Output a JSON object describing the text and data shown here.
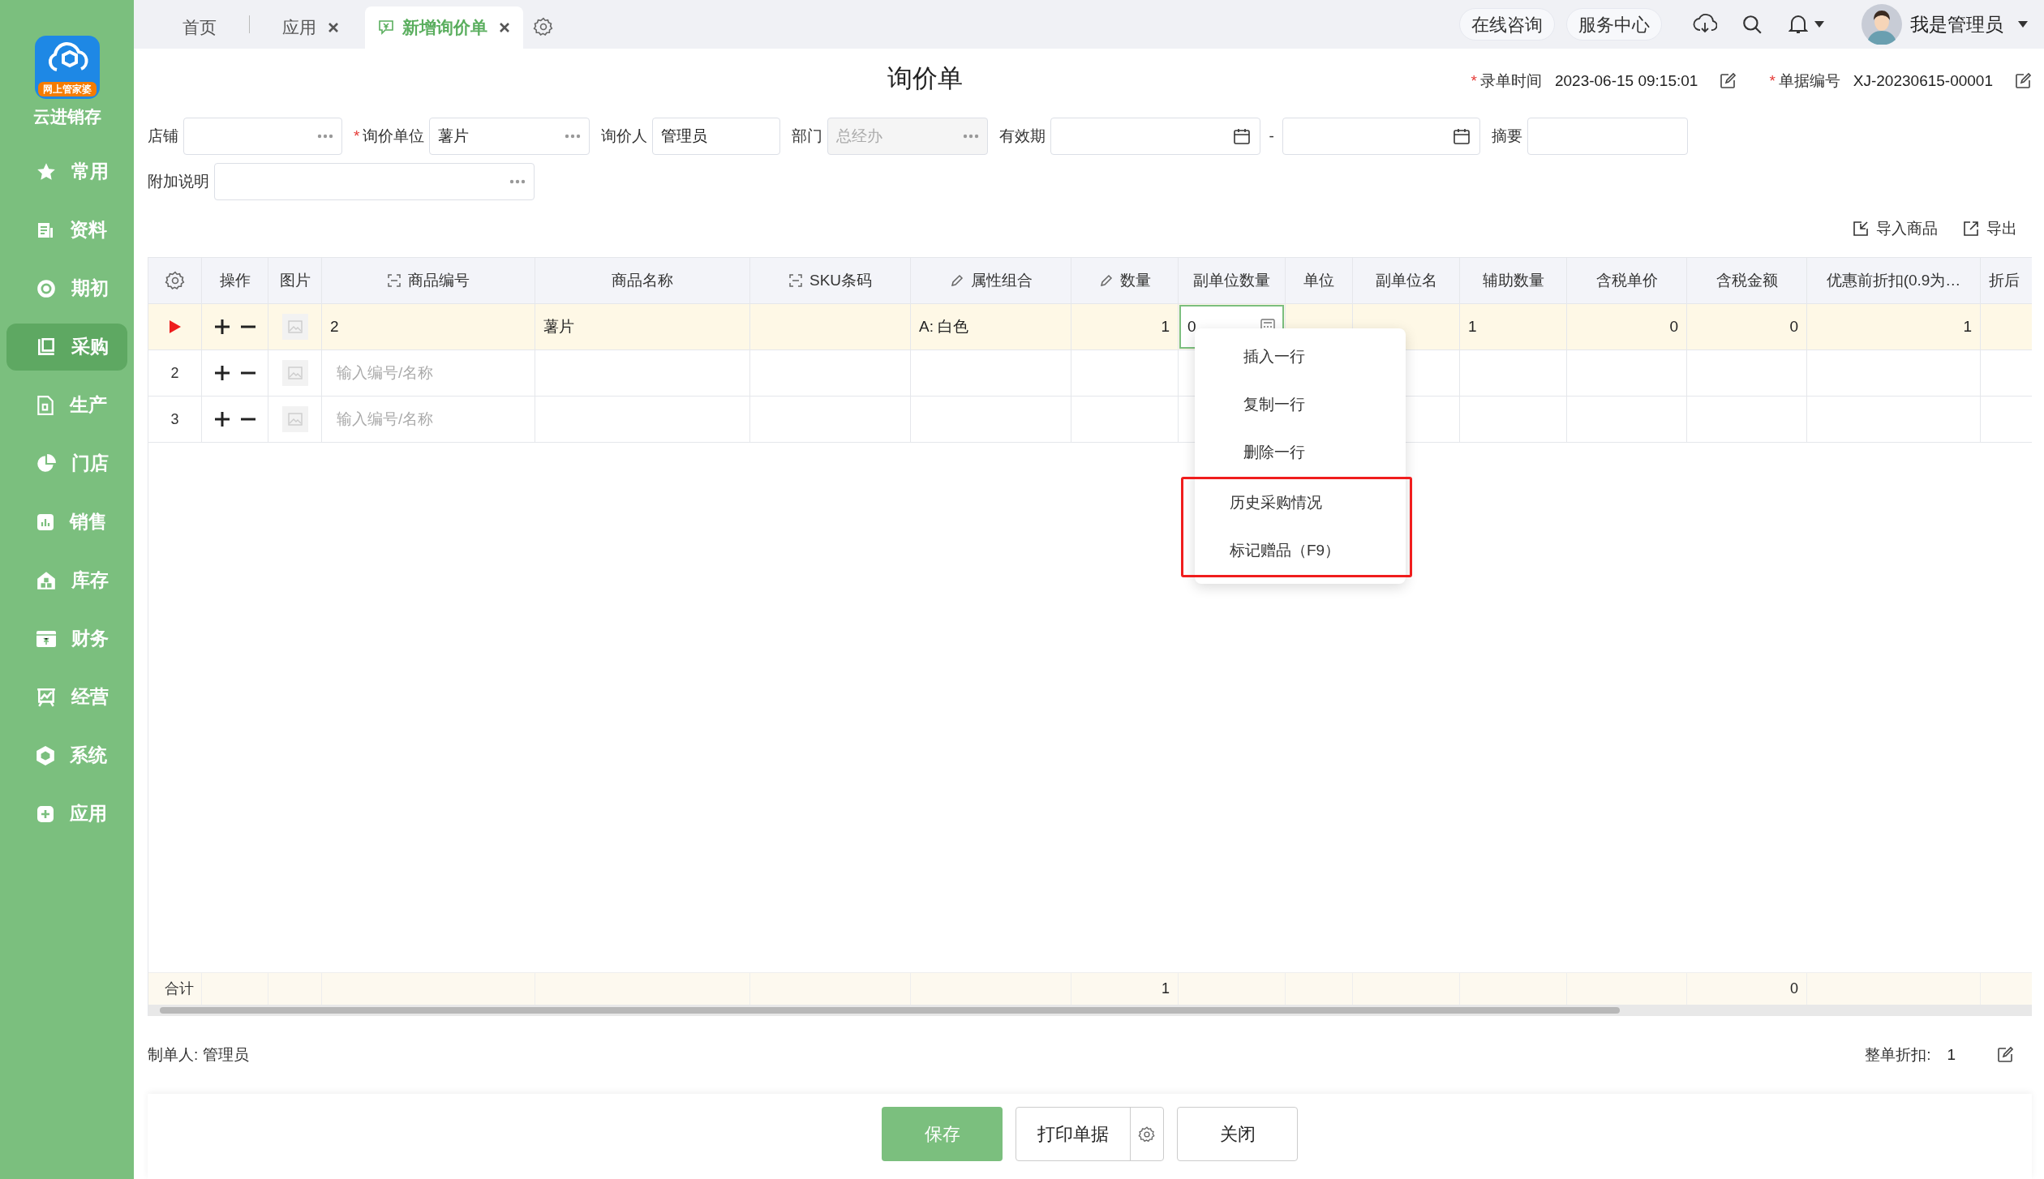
{
  "sidebar": {
    "logo_badge": "网上管家婆",
    "app_name": "云进销存",
    "items": [
      {
        "label": "常用",
        "selected": false
      },
      {
        "label": "资料",
        "selected": false
      },
      {
        "label": "期初",
        "selected": false
      },
      {
        "label": "采购",
        "selected": true
      },
      {
        "label": "生产",
        "selected": false
      },
      {
        "label": "门店",
        "selected": false
      },
      {
        "label": "销售",
        "selected": false
      },
      {
        "label": "库存",
        "selected": false
      },
      {
        "label": "财务",
        "selected": false
      },
      {
        "label": "经营",
        "selected": false
      },
      {
        "label": "系统",
        "selected": false
      },
      {
        "label": "应用",
        "selected": false
      }
    ]
  },
  "tabs": [
    {
      "label": "首页",
      "selected": false,
      "closable": false
    },
    {
      "label": "应用",
      "selected": false,
      "closable": true
    },
    {
      "label": "新增询价单",
      "selected": true,
      "closable": true
    }
  ],
  "top_actions": [
    "在线咨询",
    "服务中心"
  ],
  "user": {
    "name": "我是管理员"
  },
  "document": {
    "title": "询价单",
    "meta": [
      {
        "mark": "*",
        "label": "录单时间",
        "value": "2023-06-15 09:15:01"
      },
      {
        "mark": "*",
        "label": "单据编号",
        "value": "XJ-20230615-00001"
      }
    ]
  },
  "form_rows": [
    [
      {
        "kind": "picker",
        "label": "店铺"
      },
      {
        "kind": "picker",
        "mark": "*",
        "label": "询价单位",
        "value": "薯片"
      },
      {
        "kind": "text",
        "label": "询价人",
        "value": "管理员"
      },
      {
        "kind": "picker",
        "label": "部门",
        "placeholder": "总经办",
        "disabled": true
      },
      {
        "kind": "date_range",
        "label": "有效期",
        "separator": "-"
      },
      {
        "kind": "text",
        "label": "摘要"
      }
    ],
    [
      {
        "kind": "picker",
        "label": "附加说明"
      }
    ]
  ],
  "toolbar": [
    "导入商品",
    "导出"
  ],
  "table": {
    "columns": [
      {
        "kind": "settings"
      },
      {
        "kind": "ops",
        "label": "操作"
      },
      {
        "kind": "image",
        "label": "图片"
      },
      {
        "kind": "data",
        "label": "商品编号"
      },
      {
        "kind": "data",
        "label": "商品名称"
      },
      {
        "kind": "data",
        "label": "SKU条码"
      },
      {
        "kind": "data",
        "label": "属性组合"
      },
      {
        "kind": "data",
        "label": "数量",
        "total": "1"
      },
      {
        "kind": "data",
        "label": "副单位数量"
      },
      {
        "kind": "data",
        "label": "单位"
      },
      {
        "kind": "data",
        "label": "副单位名"
      },
      {
        "kind": "data",
        "label": "辅助数量"
      },
      {
        "kind": "data",
        "label": "含税单价"
      },
      {
        "kind": "data",
        "label": "含税金额",
        "total": "0"
      },
      {
        "kind": "data",
        "label": "优惠前折扣(0.9为…"
      },
      {
        "kind": "data",
        "label": "折后"
      }
    ],
    "rows": [
      {
        "selected": true,
        "cells": [
          "",
          "",
          "",
          "2",
          "薯片",
          "",
          "A: 白色",
          "1",
          {
            "value": "0",
            "editing": true
          },
          "",
          "",
          "1",
          "0",
          "0",
          "1"
        ]
      },
      {
        "selected": false,
        "cells": [
          "2",
          "",
          "",
          {
            "placeholder": "输入编号/名称"
          }
        ]
      },
      {
        "selected": false,
        "cells": [
          "3",
          "",
          "",
          {
            "placeholder": "输入编号/名称"
          }
        ]
      }
    ],
    "totals_label": "合计"
  },
  "context_menu": [
    {
      "label": "插入一行",
      "highlighted": false
    },
    {
      "label": "复制一行",
      "highlighted": false
    },
    {
      "label": "删除一行",
      "highlighted": false
    },
    {
      "label": "历史采购情况",
      "highlighted": true
    },
    {
      "label": "标记赠品（F9）",
      "highlighted": true
    }
  ],
  "footer": {
    "creator": "制单人: 管理员",
    "discount_label": "整单折扣:",
    "discount": "1"
  },
  "buttons": [
    {
      "label": "保存",
      "kind": "primary"
    },
    {
      "label": "打印单据",
      "kind": "split"
    },
    {
      "label": "关闭",
      "kind": "default"
    }
  ]
}
